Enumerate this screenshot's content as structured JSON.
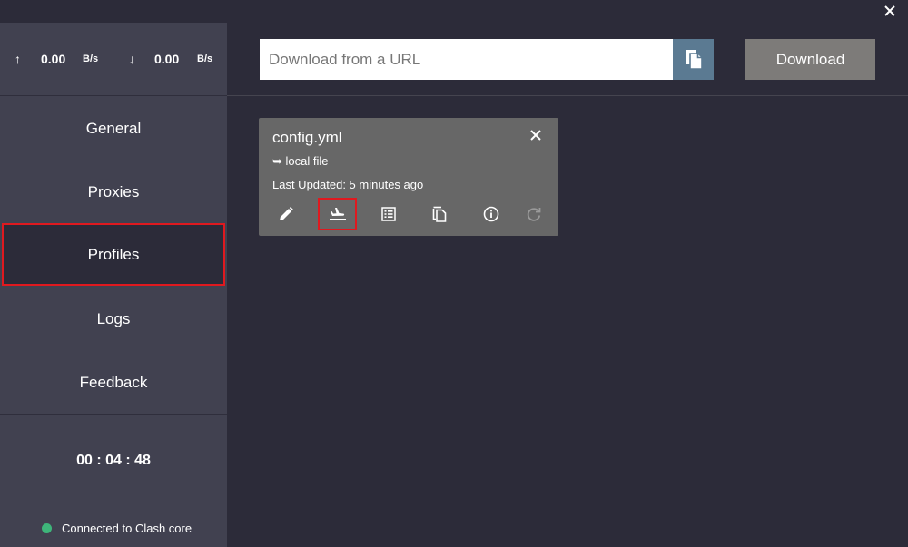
{
  "speed": {
    "up_arrow": "↑",
    "up_value": "0.00",
    "up_unit": "B/s",
    "down_arrow": "↓",
    "down_value": "0.00",
    "down_unit": "B/s"
  },
  "sidebar": {
    "items": [
      {
        "label": "General"
      },
      {
        "label": "Proxies"
      },
      {
        "label": "Profiles",
        "active": true
      },
      {
        "label": "Logs"
      },
      {
        "label": "Feedback"
      }
    ],
    "timer": "00 : 04 : 48",
    "status_text": "Connected to Clash core",
    "status_color": "#3eb57a"
  },
  "download": {
    "placeholder": "Download from a URL",
    "value": "",
    "button_label": "Download"
  },
  "profile_card": {
    "title": "config.yml",
    "source": "➥ local file",
    "last_updated": "Last Updated: 5 minutes ago",
    "actions": [
      "edit-icon",
      "select-profile-icon",
      "list-icon",
      "copy-icon",
      "info-icon",
      "refresh-icon"
    ]
  },
  "colors": {
    "highlight": "#e0191f",
    "accent_button": "#5b7a92"
  }
}
